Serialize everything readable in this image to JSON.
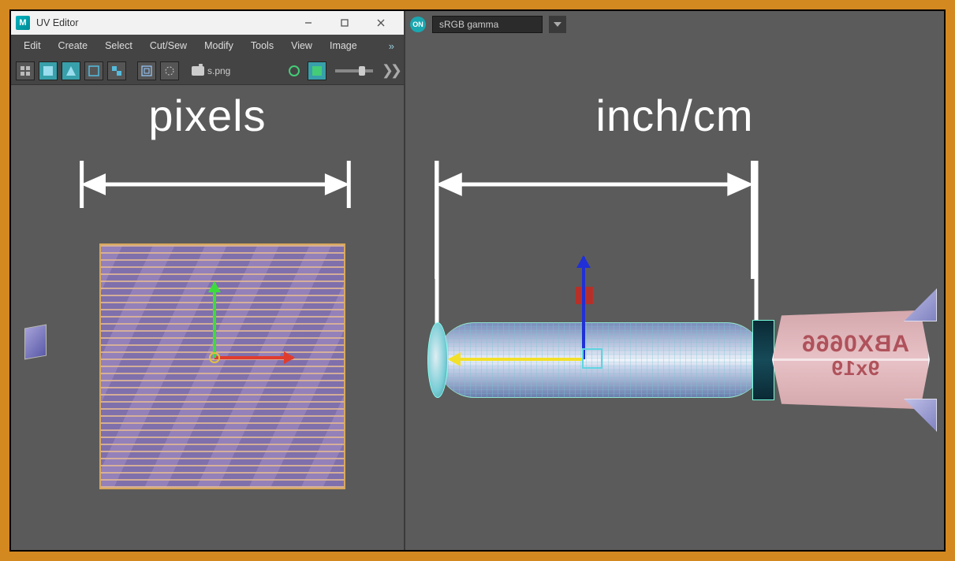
{
  "window": {
    "app_initial": "M",
    "title": "UV Editor",
    "menus": [
      "Edit",
      "Create",
      "Select",
      "Cut/Sew",
      "Modify",
      "Tools",
      "View",
      "Image"
    ],
    "image_name": "s.png"
  },
  "colorspace": {
    "toggle_label": "ON",
    "value": "sRGB gamma"
  },
  "labels": {
    "left": "pixels",
    "right": "inch/cm"
  },
  "model_text": {
    "line1": "ABX0666",
    "line2": "9x19"
  }
}
